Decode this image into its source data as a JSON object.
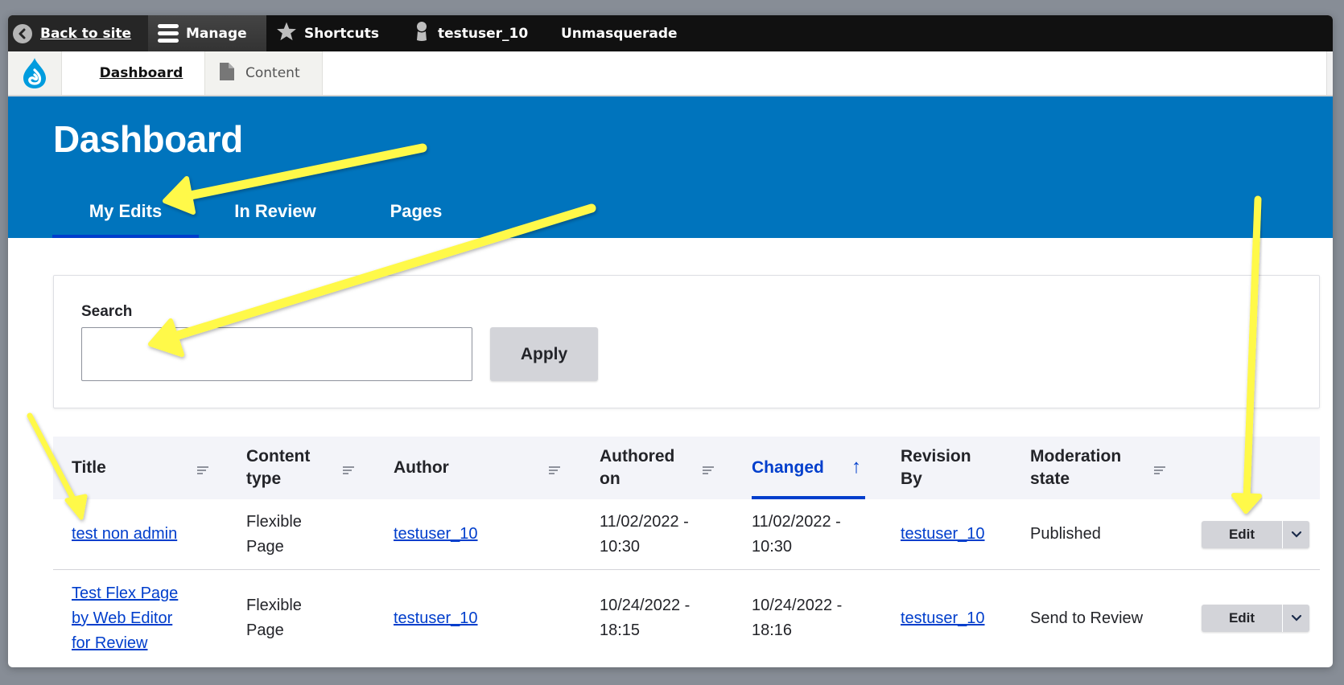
{
  "toolbar": {
    "back_label": "Back to site",
    "manage_label": "Manage",
    "shortcuts_label": "Shortcuts",
    "user_label": "testuser_10",
    "unmasquerade_label": "Unmasquerade"
  },
  "secondary_nav": {
    "items": [
      {
        "label": "Dashboard",
        "active": true
      },
      {
        "label": "Content",
        "icon": "file-icon"
      }
    ]
  },
  "header": {
    "title": "Dashboard",
    "tabs": [
      {
        "label": "My Edits",
        "active": true
      },
      {
        "label": "In Review",
        "active": false
      },
      {
        "label": "Pages",
        "active": false
      }
    ]
  },
  "filters": {
    "search_label": "Search",
    "search_value": "",
    "search_placeholder": "",
    "apply_label": "Apply"
  },
  "table": {
    "columns": [
      {
        "label": "Title",
        "sortable": true
      },
      {
        "label": "Content type",
        "sortable": true
      },
      {
        "label": "Author",
        "sortable": true
      },
      {
        "label": "Authored on",
        "sortable": true
      },
      {
        "label": "Changed",
        "sortable": true,
        "active": true,
        "direction": "asc"
      },
      {
        "label": "Revision By",
        "sortable": false
      },
      {
        "label": "Moderation state",
        "sortable": true
      },
      {
        "label": "",
        "sortable": false
      }
    ],
    "rows": [
      {
        "title": "test non admin",
        "content_type": "Flexible Page",
        "author": "testuser_10",
        "authored_on": "11/02/2022 - 10:30",
        "changed": "11/02/2022 - 10:30",
        "revision_by": "testuser_10",
        "moderation_state": "Published",
        "operation": "Edit"
      },
      {
        "title": "Test Flex Page by Web Editor for Review",
        "content_type": "Flexible Page",
        "author": "testuser_10",
        "authored_on": "10/24/2022 - 18:15",
        "changed": "10/24/2022 - 18:16",
        "revision_by": "testuser_10",
        "moderation_state": "Send to Review",
        "operation": "Edit"
      }
    ]
  },
  "colors": {
    "brand_blue": "#0074bd",
    "link_blue": "#003ecc",
    "toolbar_black": "#111111",
    "annotation_yellow": "#fff94a"
  },
  "annotations": {
    "arrow_count": 4,
    "color": "#fff94a"
  }
}
